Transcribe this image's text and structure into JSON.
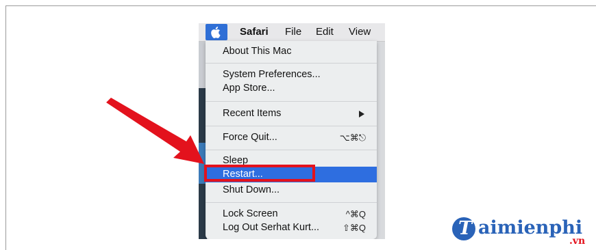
{
  "menubar": {
    "app_name": "Safari",
    "items": [
      "File",
      "Edit",
      "View"
    ]
  },
  "apple_menu": {
    "about": "About This Mac",
    "system_preferences": "System Preferences...",
    "app_store": "App Store...",
    "recent_items": "Recent Items",
    "force_quit": "Force Quit...",
    "force_quit_shortcut": "⌥⌘⎋",
    "sleep": "Sleep",
    "restart": "Restart...",
    "shut_down": "Shut Down...",
    "lock_screen": "Lock Screen",
    "lock_screen_shortcut": "^⌘Q",
    "log_out": "Log Out Serhat Kurt...",
    "log_out_shortcut": "⇧⌘Q"
  },
  "highlighted_item": "Restart...",
  "watermark": {
    "initial": "T",
    "name": "aimienphi",
    "suffix": ".vn"
  },
  "colors": {
    "highlight": "#2e6ee0",
    "annotation_red": "#e3121d",
    "brand_blue": "#2a63b8"
  }
}
